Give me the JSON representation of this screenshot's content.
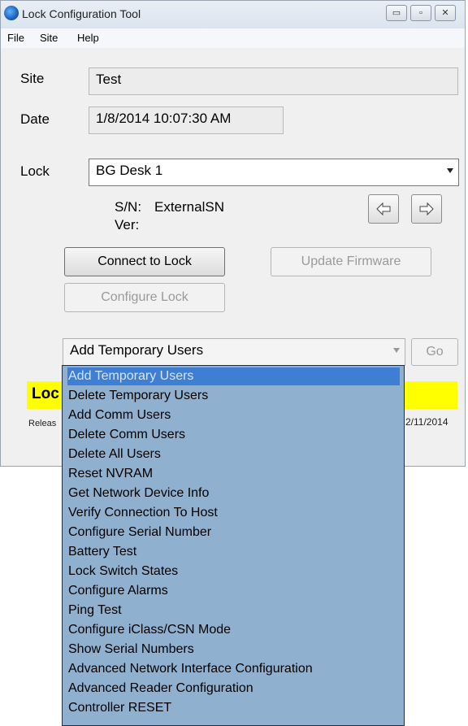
{
  "window": {
    "title": "Lock Configuration Tool",
    "controls": {
      "minimize": "▭",
      "maximize": "▫",
      "close": "✕"
    }
  },
  "menu": [
    "File",
    "Site",
    "Help"
  ],
  "site": {
    "label": "Site",
    "value": "Test"
  },
  "date": {
    "label": "Date",
    "value": "1/8/2014 10:07:30 AM"
  },
  "lock": {
    "label": "Lock",
    "value": "BG Desk 1"
  },
  "serial": {
    "label": "S/N:",
    "value": "ExternalSN"
  },
  "version": {
    "label": "Ver:",
    "value": ""
  },
  "buttons": {
    "connect": "Connect to Lock",
    "update_firmware": "Update Firmware",
    "configure_lock": "Configure Lock",
    "go": "Go"
  },
  "action": {
    "value": "Add Temporary Users"
  },
  "status": {
    "text": "Loc"
  },
  "footer": {
    "release": "Releas",
    "date": "2/11/2014"
  },
  "dropdown_items": [
    "Add Temporary Users",
    "Delete Temporary Users",
    "Add Comm Users",
    "Delete Comm Users",
    "Delete All Users",
    "Reset NVRAM",
    "Get Network Device Info",
    "Verify Connection To Host",
    "Configure Serial Number",
    "Battery Test",
    "Lock Switch States",
    "Configure Alarms",
    "Ping Test",
    "Configure iClass/CSN Mode",
    "Show Serial Numbers",
    "Advanced Network Interface Configuration",
    "Advanced Reader Configuration",
    "Controller RESET"
  ],
  "colors": {
    "status_bar": "#ffff00",
    "dropdown_bg": "#8fb0cf",
    "selected_item": "#3f7fd3"
  }
}
